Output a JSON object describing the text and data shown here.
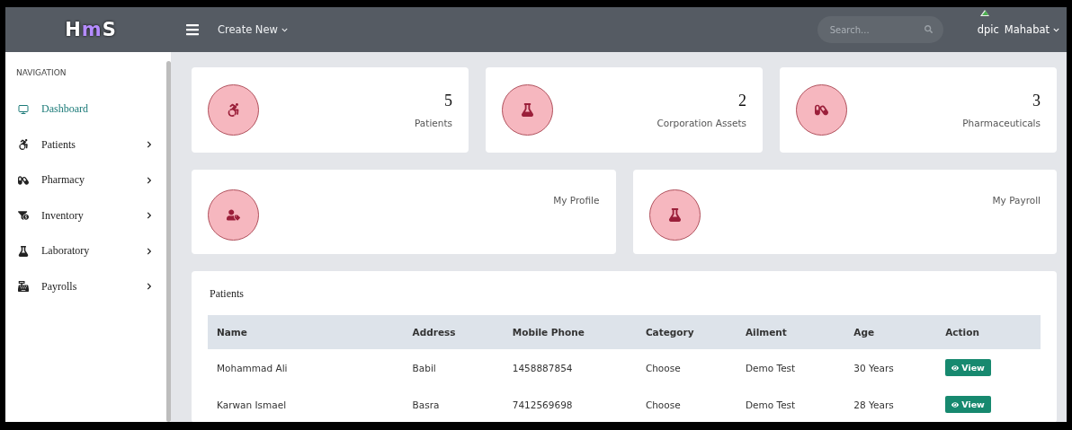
{
  "header": {
    "logo": [
      {
        "text": "H",
        "color": "#ffffff"
      },
      {
        "text": "m",
        "color": "#b58cff"
      },
      {
        "text": "S",
        "color": "#ffffff"
      }
    ],
    "create_menu": "Create New",
    "search": {
      "placeholder": "Search..."
    },
    "user": {
      "avatar_alt": "dpic",
      "name": "Mahabat"
    }
  },
  "sidebar": {
    "heading": "NAVIGATION",
    "items": [
      {
        "label": "Dashboard",
        "selected": true,
        "has_submenu": false
      },
      {
        "label": "Patients",
        "selected": false,
        "has_submenu": true
      },
      {
        "label": "Pharmacy",
        "selected": false,
        "has_submenu": true
      },
      {
        "label": "Inventory",
        "selected": false,
        "has_submenu": true
      },
      {
        "label": "Laboratory",
        "selected": false,
        "has_submenu": true
      },
      {
        "label": "Payrolls",
        "selected": false,
        "has_submenu": true
      }
    ]
  },
  "stat_cards": [
    {
      "count": "5",
      "label": "Patients"
    },
    {
      "count": "2",
      "label": "Corporation Assets"
    },
    {
      "count": "3",
      "label": "Pharmaceuticals"
    }
  ],
  "link_cards": [
    {
      "label": "My Profile"
    },
    {
      "label": "My Payroll"
    }
  ],
  "table": {
    "title": "Patients",
    "columns": [
      "Name",
      "Address",
      "Mobile Phone",
      "Category",
      "Ailment",
      "Age",
      "Action"
    ],
    "rows": [
      {
        "cells": [
          "Mohammad Ali",
          "Babil",
          "1458887854",
          "Choose",
          "Demo Test",
          "30 Years"
        ],
        "action": "View"
      },
      {
        "cells": [
          "Karwan Ismael",
          "Basra",
          "7412569698",
          "Choose",
          "Demo Test",
          "28 Years"
        ],
        "action": "View"
      }
    ]
  }
}
